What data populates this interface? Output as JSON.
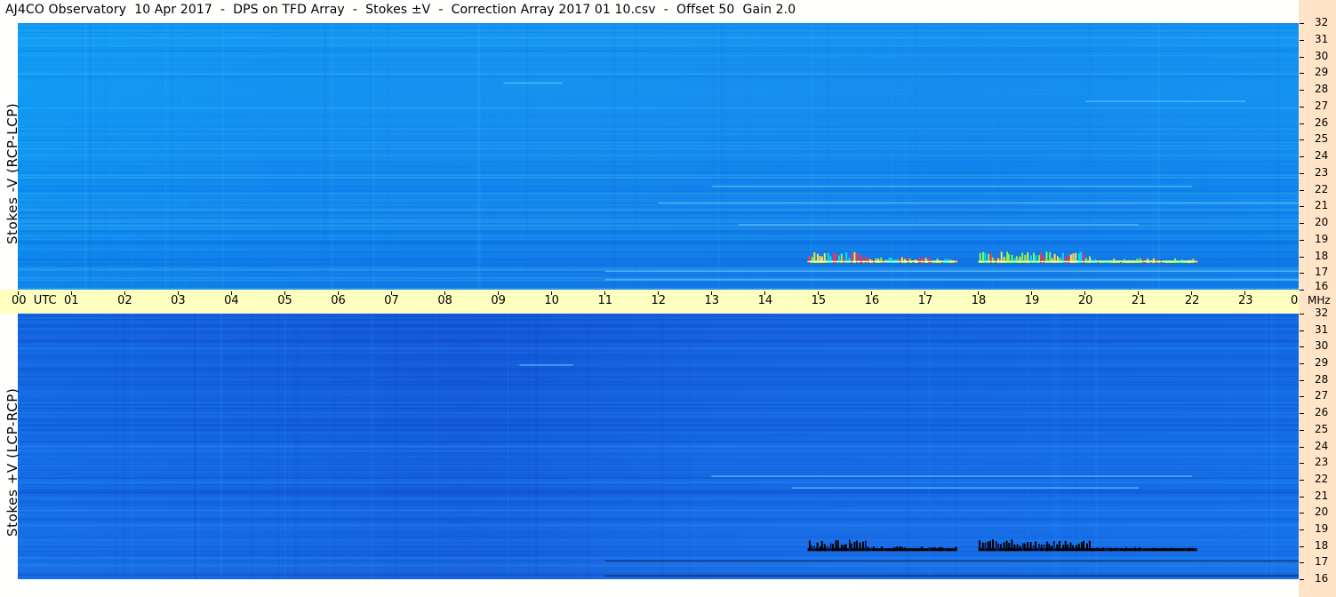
{
  "window": {
    "title": "AJ4CO Observatory  10 Apr 2017  -  DPS on TFD Array  -  Stokes ±V  -  Correction Array 2017 01 10.csv  -  Offset 50  Gain 2.0"
  },
  "chart_data": [
    {
      "type": "heatmap",
      "title": "AJ4CO Observatory  10 Apr 2017  -  DPS on TFD Array  -  Stokes ±V  -  Correction Array 2017 01 10.csv  -  Offset 50  Gain 2.0",
      "panel": "top",
      "ylabel": "Stokes -V (RCP-LCP)",
      "xlabel": "UTC",
      "x_tick_labels": [
        "00",
        "01",
        "02",
        "03",
        "04",
        "05",
        "06",
        "07",
        "08",
        "09",
        "10",
        "11",
        "12",
        "13",
        "14",
        "15",
        "16",
        "17",
        "18",
        "19",
        "20",
        "21",
        "22",
        "23",
        "00"
      ],
      "x_range_hours": [
        0,
        24
      ],
      "y_unit": "MHz",
      "y_tick_labels": [
        "32",
        "31",
        "30",
        "29",
        "28",
        "27",
        "26",
        "25",
        "24",
        "23",
        "22",
        "21",
        "20",
        "19",
        "18",
        "17",
        "16"
      ],
      "y_range_mhz": [
        16,
        32
      ],
      "colormap": "blue background, green/yellow/red/white for strong positive signal",
      "features": [
        {
          "kind": "burst",
          "t_start": 14.8,
          "t_end": 15.9,
          "f_low": 17.6,
          "f_high": 18.3,
          "strength": "strong"
        },
        {
          "kind": "burst",
          "t_start": 15.9,
          "t_end": 17.6,
          "f_low": 17.6,
          "f_high": 18.1,
          "strength": "medium"
        },
        {
          "kind": "burst",
          "t_start": 18.0,
          "t_end": 20.1,
          "f_low": 17.6,
          "f_high": 18.3,
          "strength": "strong"
        },
        {
          "kind": "burst",
          "t_start": 20.1,
          "t_end": 22.1,
          "f_low": 17.6,
          "f_high": 18.0,
          "strength": "medium"
        },
        {
          "kind": "line",
          "t_start": 11.0,
          "t_end": 24.0,
          "f": 17.1,
          "strength": "weak"
        },
        {
          "kind": "line",
          "t_start": 11.0,
          "t_end": 24.0,
          "f": 16.6,
          "strength": "weak"
        },
        {
          "kind": "line",
          "t_start": 12.0,
          "t_end": 24.0,
          "f": 21.2,
          "strength": "weak"
        },
        {
          "kind": "line",
          "t_start": 13.0,
          "t_end": 22.0,
          "f": 22.2,
          "strength": "weak"
        },
        {
          "kind": "line",
          "t_start": 13.5,
          "t_end": 21.0,
          "f": 19.9,
          "strength": "weak"
        },
        {
          "kind": "line",
          "t_start": 20.0,
          "t_end": 23.0,
          "f": 27.3,
          "strength": "weak"
        },
        {
          "kind": "line",
          "t_start": 9.1,
          "t_end": 10.2,
          "f": 28.4,
          "strength": "weak"
        }
      ],
      "colors": {
        "background": "#1585ec",
        "signal_low": "#00e0ff",
        "signal_mid": "#7cff40",
        "signal_high": "#ff3050",
        "signal_peak": "#ffffff"
      }
    },
    {
      "type": "heatmap",
      "panel": "bottom",
      "ylabel": "Stokes +V (LCP-RCP)",
      "xlabel": "UTC",
      "x_tick_labels": [
        "00",
        "01",
        "02",
        "03",
        "04",
        "05",
        "06",
        "07",
        "08",
        "09",
        "10",
        "11",
        "12",
        "13",
        "14",
        "15",
        "16",
        "17",
        "18",
        "19",
        "20",
        "21",
        "22",
        "23",
        "00"
      ],
      "x_range_hours": [
        0,
        24
      ],
      "y_unit": "MHz",
      "y_tick_labels": [
        "32",
        "31",
        "30",
        "29",
        "28",
        "27",
        "26",
        "25",
        "24",
        "23",
        "22",
        "21",
        "20",
        "19",
        "18",
        "17",
        "16"
      ],
      "y_range_mhz": [
        16,
        32
      ],
      "colormap": "blue background, black for negative signal",
      "features": [
        {
          "kind": "burst",
          "t_start": 14.8,
          "t_end": 15.9,
          "f_low": 17.7,
          "f_high": 18.4,
          "strength": "strong"
        },
        {
          "kind": "burst",
          "t_start": 15.9,
          "t_end": 17.6,
          "f_low": 17.7,
          "f_high": 18.1,
          "strength": "medium"
        },
        {
          "kind": "burst",
          "t_start": 18.0,
          "t_end": 20.1,
          "f_low": 17.7,
          "f_high": 18.4,
          "strength": "strong"
        },
        {
          "kind": "burst",
          "t_start": 20.1,
          "t_end": 22.1,
          "f_low": 17.7,
          "f_high": 18.0,
          "strength": "medium"
        },
        {
          "kind": "line",
          "t_start": 11.0,
          "t_end": 24.0,
          "f": 17.1,
          "strength": "weak"
        },
        {
          "kind": "line",
          "t_start": 11.0,
          "t_end": 24.0,
          "f": 16.2,
          "strength": "weak"
        },
        {
          "kind": "line",
          "t_start": 13.0,
          "t_end": 22.0,
          "f": 22.2,
          "strength": "weak"
        },
        {
          "kind": "line",
          "t_start": 14.5,
          "t_end": 21.0,
          "f": 21.5,
          "strength": "weak"
        },
        {
          "kind": "line",
          "t_start": 9.4,
          "t_end": 10.4,
          "f": 28.9,
          "strength": "weak"
        }
      ],
      "colors": {
        "background": "#1662e2",
        "signal_low": "#00e0ff",
        "signal_neg": "#000000"
      }
    }
  ],
  "axis": {
    "time_labels": [
      "00  UTC",
      "01",
      "02",
      "03",
      "04",
      "05",
      "06",
      "07",
      "08",
      "09",
      "10",
      "11",
      "12",
      "13",
      "14",
      "15",
      "16",
      "17",
      "18",
      "19",
      "20",
      "21",
      "22",
      "23",
      "00"
    ],
    "freq_unit": "MHz",
    "freq_labels": [
      "32",
      "31",
      "30",
      "29",
      "28",
      "27",
      "26",
      "25",
      "24",
      "23",
      "22",
      "21",
      "20",
      "19",
      "18",
      "17",
      "16"
    ]
  }
}
